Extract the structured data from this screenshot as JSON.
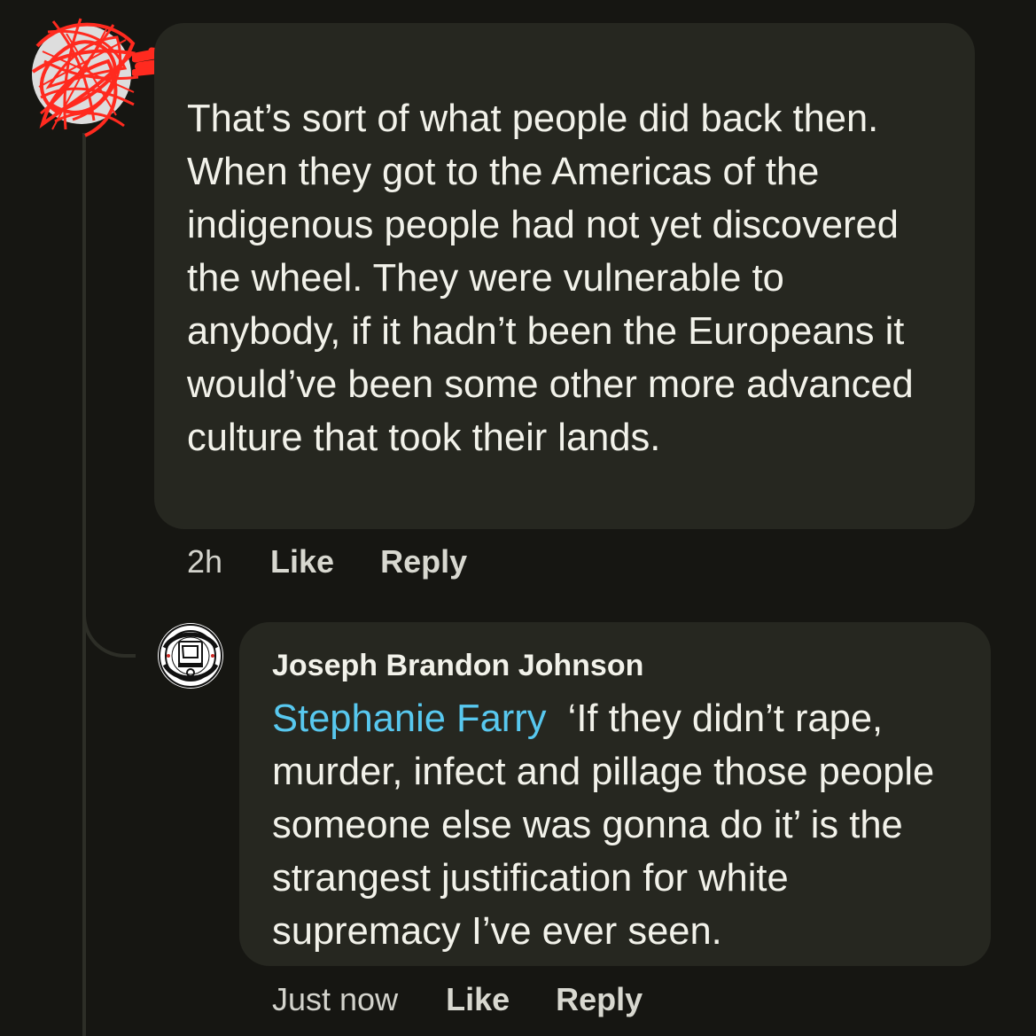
{
  "thread": {
    "comments": [
      {
        "text": "That’s sort of what people did back then. When they got to the Americas of the indigenous people had not yet discovered the wheel. They were vulnerable to anybody, if it hadn’t been the Europeans it would’ve been some other more advanced culture that took their lands.",
        "time": "2h",
        "like_label": "Like",
        "reply_label": "Reply"
      },
      {
        "author": "Joseph Brandon Johnson",
        "mention": "Stephanie Farry",
        "text": "‘If they didn’t rape, murder, infect and pillage those people someone else was gonna do it’ is the strangest justification for white supremacy I’ve ever seen.",
        "time": "Just now",
        "like_label": "Like",
        "reply_label": "Reply"
      }
    ]
  },
  "colors": {
    "background": "#161612",
    "bubble": "#262720",
    "text": "#f2f2ea",
    "mention": "#58c8ef",
    "redaction": "#ff2a1f"
  },
  "icons": {
    "first_avatar": "redacted-avatar-icon",
    "second_avatar": "circular-logo-avatar-icon"
  }
}
